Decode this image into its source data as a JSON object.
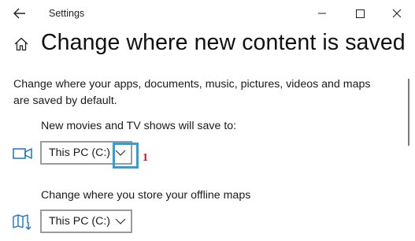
{
  "window": {
    "title": "Settings",
    "minimize_glyph": "minimize",
    "maximize_glyph": "maximize",
    "close_glyph": "close"
  },
  "page": {
    "title": "Change where new content is saved",
    "description": "Change where your apps, documents, music, pictures, videos and maps are saved by default."
  },
  "sections": [
    {
      "label": "New movies and TV shows will save to:",
      "icon": "video-icon",
      "selected_value": "This PC (C:)"
    },
    {
      "label": "Change where you store your offline maps",
      "icon": "map-icon",
      "selected_value": "This PC (C:)"
    }
  ],
  "annotation": {
    "number": "1",
    "color": "#cc1111",
    "box_color": "#2e9fd8"
  }
}
